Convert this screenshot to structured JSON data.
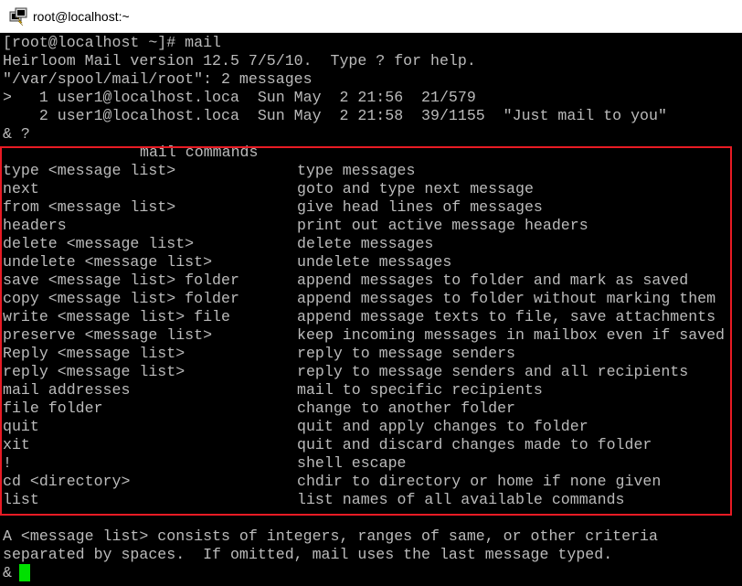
{
  "window": {
    "title": "root@localhost:~",
    "icon": "putty-terminal-icon"
  },
  "session": {
    "lines": [
      "[root@localhost ~]# mail",
      "Heirloom Mail version 12.5 7/5/10.  Type ? for help.",
      "\"/var/spool/mail/root\": 2 messages",
      ">   1 user1@localhost.loca  Sun May  2 21:56  21/579",
      "    2 user1@localhost.loca  Sun May  2 21:58  39/1155  \"Just mail to you\"",
      "& ?"
    ]
  },
  "help": {
    "heading": "mail commands",
    "commands": [
      {
        "cmd": "type <message list>",
        "desc": "type messages"
      },
      {
        "cmd": "next",
        "desc": "goto and type next message"
      },
      {
        "cmd": "from <message list>",
        "desc": "give head lines of messages"
      },
      {
        "cmd": "headers",
        "desc": "print out active message headers"
      },
      {
        "cmd": "delete <message list>",
        "desc": "delete messages"
      },
      {
        "cmd": "undelete <message list>",
        "desc": "undelete messages"
      },
      {
        "cmd": "save <message list> folder",
        "desc": "append messages to folder and mark as saved"
      },
      {
        "cmd": "copy <message list> folder",
        "desc": "append messages to folder without marking them"
      },
      {
        "cmd": "write <message list> file",
        "desc": "append message texts to file, save attachments"
      },
      {
        "cmd": "preserve <message list>",
        "desc": "keep incoming messages in mailbox even if saved"
      },
      {
        "cmd": "Reply <message list>",
        "desc": "reply to message senders"
      },
      {
        "cmd": "reply <message list>",
        "desc": "reply to message senders and all recipients"
      },
      {
        "cmd": "mail addresses",
        "desc": "mail to specific recipients"
      },
      {
        "cmd": "file folder",
        "desc": "change to another folder"
      },
      {
        "cmd": "quit",
        "desc": "quit and apply changes to folder"
      },
      {
        "cmd": "xit",
        "desc": "quit and discard changes made to folder"
      },
      {
        "cmd": "!",
        "desc": "shell escape"
      },
      {
        "cmd": "cd <directory>",
        "desc": "chdir to directory or home if none given"
      },
      {
        "cmd": "list",
        "desc": "list names of all available commands"
      }
    ],
    "footer": [
      "A <message list> consists of integers, ranges of same, or other criteria",
      "separated by spaces.  If omitted, mail uses the last message typed."
    ]
  },
  "prompt": "&",
  "colors": {
    "background": "#000000",
    "text": "#bbbbbb",
    "cursor": "#00e000",
    "highlight": "#e81b24"
  }
}
